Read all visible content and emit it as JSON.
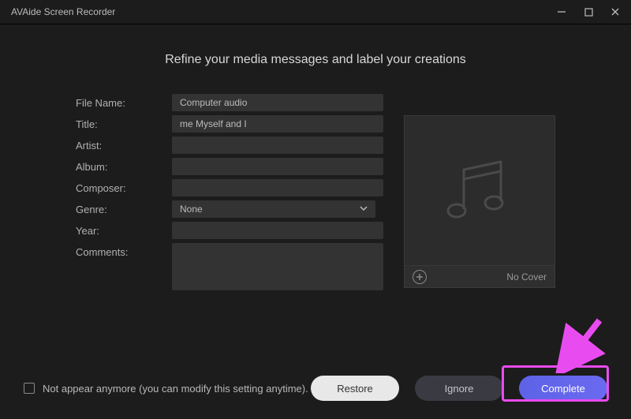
{
  "titlebar": {
    "title": "AVAide Screen Recorder"
  },
  "heading": "Refine your media messages and label your creations",
  "labels": {
    "file_name": "File Name:",
    "title": "Title:",
    "artist": "Artist:",
    "album": "Album:",
    "composer": "Composer:",
    "genre": "Genre:",
    "year": "Year:",
    "comments": "Comments:"
  },
  "values": {
    "file_name": "Computer audio",
    "title": "me Myself and I",
    "artist": "",
    "album": "",
    "composer": "",
    "genre": "None",
    "year": "",
    "comments": ""
  },
  "cover": {
    "no_cover": "No Cover"
  },
  "footer": {
    "not_appear": "Not appear anymore (you can modify this setting anytime).",
    "restore": "Restore",
    "ignore": "Ignore",
    "complete": "Complete"
  },
  "annotation": {
    "highlight_color": "#e84cf0"
  }
}
